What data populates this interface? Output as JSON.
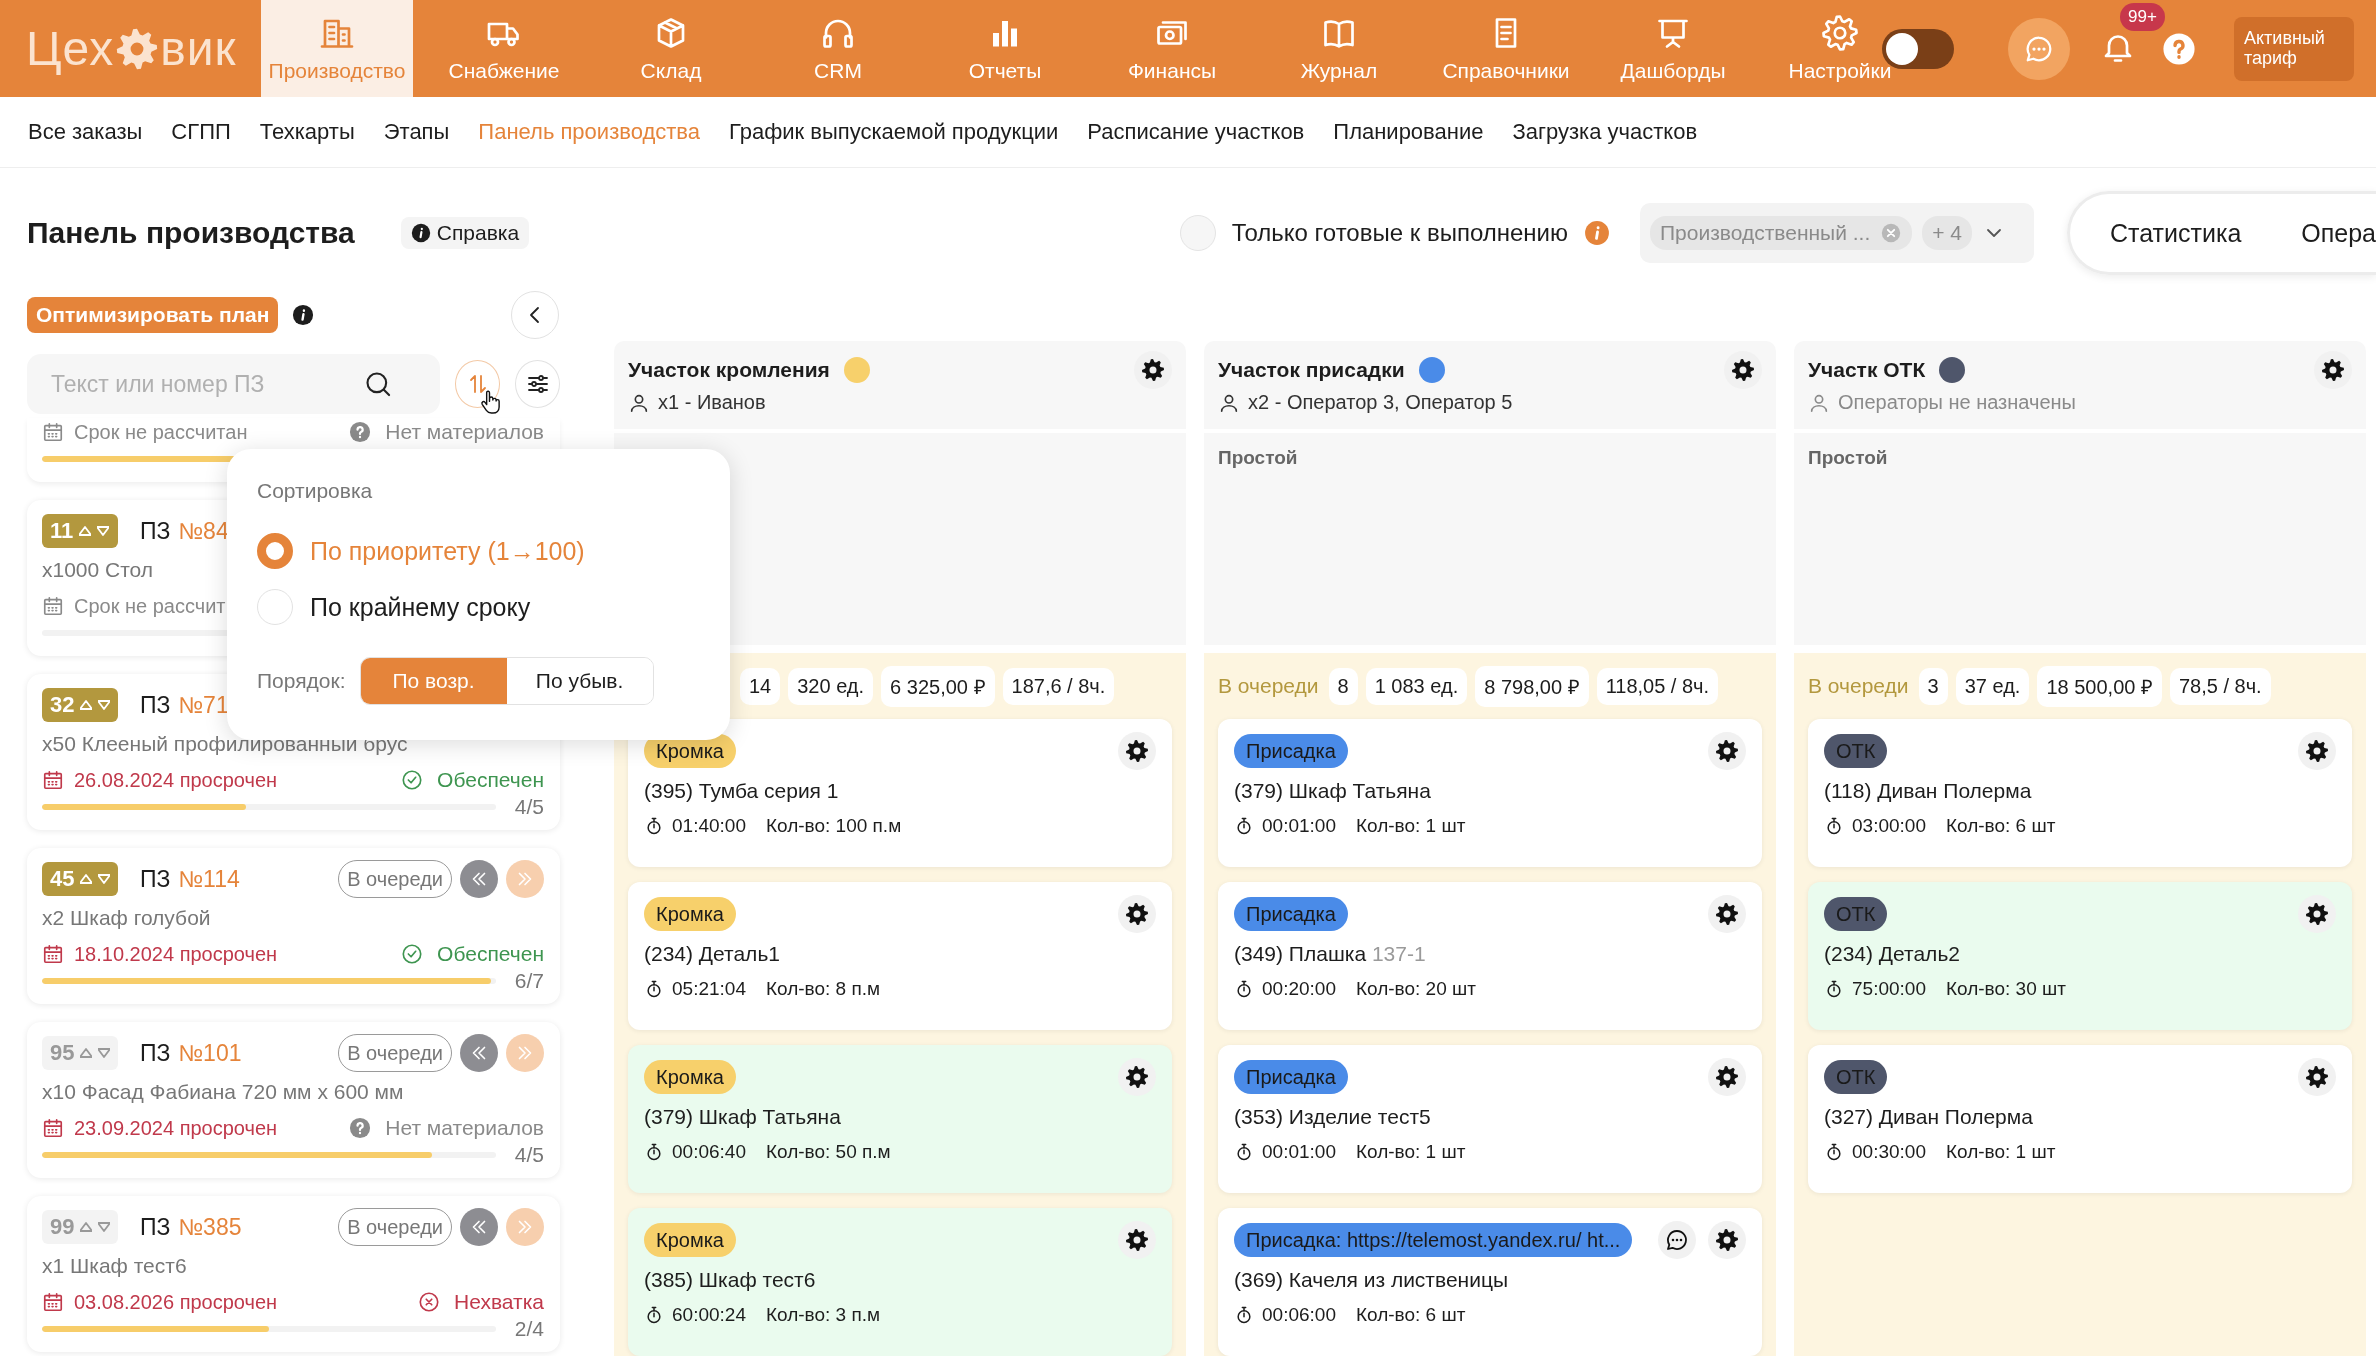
{
  "logo": {
    "start": "Цех",
    "end": "вик"
  },
  "nav": [
    {
      "label": "Производство",
      "selected": true
    },
    {
      "label": "Снабжение",
      "selected": false
    },
    {
      "label": "Склад",
      "selected": false
    },
    {
      "label": "CRM",
      "selected": false
    },
    {
      "label": "Отчеты",
      "selected": false
    },
    {
      "label": "Финансы",
      "selected": false
    },
    {
      "label": "Журнал",
      "selected": false
    },
    {
      "label": "Справочники",
      "selected": false
    },
    {
      "label": "Дашборды",
      "selected": false
    },
    {
      "label": "Настройки",
      "selected": false
    }
  ],
  "theme_switch": {
    "on": false
  },
  "notifications": {
    "badge": "99+"
  },
  "tariff_button": "Активный тариф",
  "subnav": [
    {
      "label": "Все заказы",
      "selected": false
    },
    {
      "label": "СГПП",
      "selected": false
    },
    {
      "label": "Техкарты",
      "selected": false
    },
    {
      "label": "Этапы",
      "selected": false
    },
    {
      "label": "Панель производства",
      "selected": true
    },
    {
      "label": "График выпускаемой продукции",
      "selected": false
    },
    {
      "label": "Расписание участков",
      "selected": false
    },
    {
      "label": "Планирование",
      "selected": false
    },
    {
      "label": "Загрузка участков",
      "selected": false
    }
  ],
  "page_title": "Панель производства",
  "help_link": "Справка",
  "ready_filter": {
    "label": "Только готовые к выполнению",
    "checked": false
  },
  "area_filter": {
    "value": "Производственный ...",
    "more": "+ 4"
  },
  "view_tabs": [
    {
      "label": "Статистика",
      "selected": false
    },
    {
      "label": "Опера",
      "selected": false
    }
  ],
  "optimize_button": "Оптимизировать план",
  "search": {
    "placeholder": "Текст или номер ПЗ"
  },
  "orders": [
    {
      "cut": true,
      "deadline": "Срок не рассчитан",
      "overdue": false,
      "supply": {
        "kind": "missing",
        "label": "Нет материалов"
      },
      "level": 0.45
    },
    {
      "cut": false,
      "priority": "11",
      "highlighted": true,
      "label": "ПЗ",
      "number": "№84",
      "title": "x1000 Стол",
      "deadline": "Срок не рассчит",
      "overdue": false,
      "level": 0
    },
    {
      "cut": false,
      "priority": "32",
      "highlighted": true,
      "label": "ПЗ",
      "number": "№71",
      "title": "x50 Клееный профилированный брус",
      "deadline": "26.08.2024 просрочен",
      "overdue": true,
      "supply": {
        "kind": "ok",
        "label": "Обеспечен"
      },
      "level": 0.45,
      "count": "4/5"
    },
    {
      "cut": false,
      "priority": "45",
      "highlighted": true,
      "label": "ПЗ",
      "number": "№114",
      "status": "В очереди",
      "title": "x2 Шкаф голубой",
      "deadline": "18.10.2024 просрочен",
      "overdue": true,
      "supply": {
        "kind": "ok",
        "label": "Обеспечен"
      },
      "level": 0.99,
      "count": "6/7"
    },
    {
      "cut": false,
      "priority": "95",
      "highlighted": false,
      "label": "ПЗ",
      "number": "№101",
      "status": "В очереди",
      "title": "x10 Фасад Фабиана 720 мм x 600 мм",
      "deadline": "23.09.2024 просрочен",
      "overdue": true,
      "supply": {
        "kind": "missing",
        "label": "Нет материалов"
      },
      "level": 0.86,
      "count": "4/5"
    },
    {
      "cut": false,
      "priority": "99",
      "highlighted": false,
      "label": "ПЗ",
      "number": "№385",
      "status": "В очереди",
      "title": "x1 Шкаф тест6",
      "deadline": "03.08.2026 просрочен",
      "overdue": true,
      "supply": {
        "kind": "short",
        "label": "Нехватка"
      },
      "level": 0.5,
      "count": "2/4"
    }
  ],
  "sort_popup": {
    "title": "Сортировка",
    "options": [
      {
        "label": "По приоритету (1→100)",
        "selected": true
      },
      {
        "label": "По крайнему сроку",
        "selected": false
      }
    ],
    "order_label": "Порядок:",
    "order_options": [
      {
        "label": "По возр.",
        "selected": true
      },
      {
        "label": "По убыв.",
        "selected": false
      }
    ]
  },
  "columns": [
    {
      "title": "Участок кромления",
      "color": "#f7d06b",
      "operators": "x1 - Иванов",
      "operators_assigned": true,
      "stats": [
        "14",
        "320 ед.",
        "6 325,00 ₽",
        "187,6 / 8ч."
      ],
      "tasks": [
        {
          "tag": "Кромка",
          "color": "#f7d06b",
          "title": "(395) Тумба серия 1",
          "time": "01:40:00",
          "qty": "Кол-во: 100 п.м",
          "highlighted": false,
          "comment": false
        },
        {
          "tag": "Кромка",
          "color": "#f7d06b",
          "title": "(234) Деталь1",
          "time": "05:21:04",
          "qty": "Кол-во: 8 п.м",
          "highlighted": false,
          "comment": false
        },
        {
          "tag": "Кромка",
          "color": "#f7d06b",
          "title": "(379) Шкаф Татьяна",
          "time": "00:06:40",
          "qty": "Кол-во: 50 п.м",
          "highlighted": true,
          "comment": false
        },
        {
          "tag": "Кромка",
          "color": "#f7d06b",
          "title": "(385) Шкаф тест6",
          "time": "60:00:24",
          "qty": "Кол-во: 3 п.м",
          "highlighted": true,
          "comment": false
        }
      ]
    },
    {
      "title": "Участок присадки",
      "color": "#4a8be8",
      "operators": "x2 - Оператор 3, Оператор 5",
      "operators_assigned": true,
      "idle_label": "Простой",
      "queue_label": "В очереди",
      "stats": [
        "8",
        "1 083 ед.",
        "8 798,00 ₽",
        "118,05 / 8ч."
      ],
      "tasks": [
        {
          "tag": "Присадка",
          "color": "#4a8be8",
          "title": "(379) Шкаф Татьяна",
          "time": "00:01:00",
          "qty": "Кол-во: 1 шт",
          "highlighted": false,
          "comment": false
        },
        {
          "tag": "Присадка",
          "color": "#4a8be8",
          "title": "(349) Плашка",
          "title_suffix": "137-1",
          "time": "00:20:00",
          "qty": "Кол-во: 20 шт",
          "highlighted": false,
          "comment": false
        },
        {
          "tag": "Присадка",
          "color": "#4a8be8",
          "title": "(353) Изделие тест5",
          "time": "00:01:00",
          "qty": "Кол-во: 1 шт",
          "highlighted": false,
          "comment": false
        },
        {
          "tag": "Присадка: https://telemost.yandex.ru/ ht...",
          "color": "#4a8be8",
          "title": "(369) Качеля из лиственицы",
          "time": "00:06:00",
          "qty": "Кол-во: 6 шт",
          "highlighted": false,
          "comment": true
        }
      ]
    },
    {
      "title": "Участк ОТК",
      "color": "#4f566b",
      "operators": "Операторы не назначены",
      "operators_assigned": false,
      "idle_label": "Простой",
      "queue_label": "В очереди",
      "stats": [
        "3",
        "37 ед.",
        "18 500,00 ₽",
        "78,5 / 8ч."
      ],
      "tasks": [
        {
          "tag": "ОТК",
          "color": "#4f566b",
          "title": "(118) Диван Полерма",
          "time": "03:00:00",
          "qty": "Кол-во: 6 шт",
          "highlighted": false,
          "comment": false
        },
        {
          "tag": "ОТК",
          "color": "#4f566b",
          "title": "(234) Деталь2",
          "time": "75:00:00",
          "qty": "Кол-во: 30 шт",
          "highlighted": true,
          "comment": false
        },
        {
          "tag": "ОТК",
          "color": "#4f566b",
          "title": "(327) Диван Полерма",
          "time": "00:30:00",
          "qty": "Кол-во: 1 шт",
          "highlighted": false,
          "comment": false
        }
      ]
    }
  ]
}
